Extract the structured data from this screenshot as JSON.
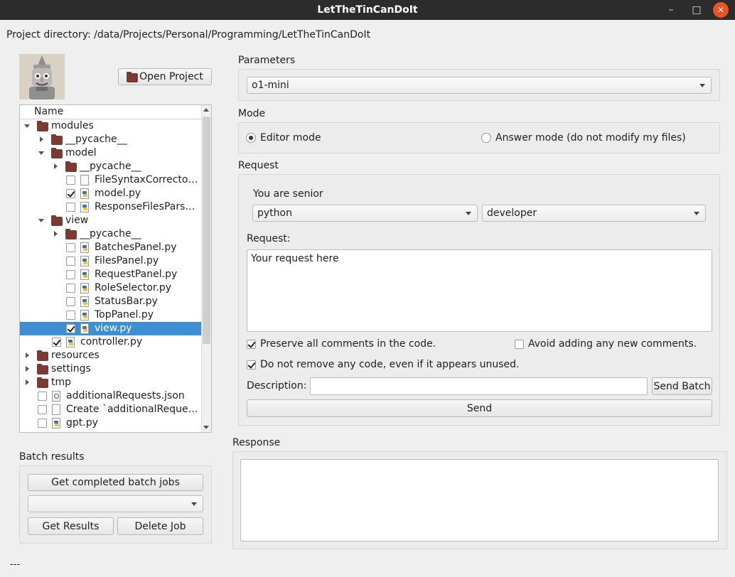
{
  "window": {
    "title": "LetTheTinCanDoIt",
    "minimize_glyph": "–",
    "maximize_glyph": "□",
    "close_glyph": "✕"
  },
  "project": {
    "directory_label": "Project directory: /data/Projects/Personal/Programming/LetTheTinCanDoIt",
    "open_button": "Open Project"
  },
  "tree": {
    "header": "Name",
    "rows": [
      {
        "label": "modules",
        "type": "folder",
        "depth": 0,
        "expander": "open",
        "checkbox": false
      },
      {
        "label": "__pycache__",
        "type": "folder",
        "depth": 1,
        "expander": "closed",
        "checkbox": false
      },
      {
        "label": "model",
        "type": "folder",
        "depth": 1,
        "expander": "open",
        "checkbox": false
      },
      {
        "label": "__pycache__",
        "type": "folder",
        "depth": 2,
        "expander": "closed",
        "checkbox": false
      },
      {
        "label": "FileSyntaxCorrecto…",
        "type": "file",
        "depth": 2,
        "checkbox": true,
        "checked": false
      },
      {
        "label": "model.py",
        "type": "py",
        "depth": 2,
        "checkbox": true,
        "checked": true
      },
      {
        "label": "ResponseFilesPars…",
        "type": "py",
        "depth": 2,
        "checkbox": true,
        "checked": false
      },
      {
        "label": "view",
        "type": "folder",
        "depth": 1,
        "expander": "open",
        "checkbox": false
      },
      {
        "label": "__pycache__",
        "type": "folder",
        "depth": 2,
        "expander": "closed",
        "checkbox": false
      },
      {
        "label": "BatchesPanel.py",
        "type": "py",
        "depth": 2,
        "checkbox": true,
        "checked": false
      },
      {
        "label": "FilesPanel.py",
        "type": "py",
        "depth": 2,
        "checkbox": true,
        "checked": false
      },
      {
        "label": "RequestPanel.py",
        "type": "py",
        "depth": 2,
        "checkbox": true,
        "checked": false
      },
      {
        "label": "RoleSelector.py",
        "type": "py",
        "depth": 2,
        "checkbox": true,
        "checked": false
      },
      {
        "label": "StatusBar.py",
        "type": "py",
        "depth": 2,
        "checkbox": true,
        "checked": false
      },
      {
        "label": "TopPanel.py",
        "type": "py",
        "depth": 2,
        "checkbox": true,
        "checked": false
      },
      {
        "label": "view.py",
        "type": "py",
        "depth": 2,
        "checkbox": true,
        "checked": true,
        "selected": true
      },
      {
        "label": "controller.py",
        "type": "py",
        "depth": 1,
        "checkbox": true,
        "checked": true
      },
      {
        "label": "resources",
        "type": "folder",
        "depth": 0,
        "expander": "closed",
        "checkbox": false
      },
      {
        "label": "settings",
        "type": "folder",
        "depth": 0,
        "expander": "closed",
        "checkbox": false
      },
      {
        "label": "tmp",
        "type": "folder",
        "depth": 0,
        "expander": "closed",
        "checkbox": false
      },
      {
        "label": "additionalRequests.json",
        "type": "json",
        "depth": 0,
        "checkbox": true,
        "checked": false
      },
      {
        "label": "Create `additionalReque…",
        "type": "file",
        "depth": 0,
        "checkbox": true,
        "checked": false
      },
      {
        "label": "gpt.py",
        "type": "py",
        "depth": 0,
        "checkbox": true,
        "checked": false
      }
    ]
  },
  "batch": {
    "title": "Batch results",
    "get_completed": "Get completed batch jobs",
    "select_value": "",
    "get_results": "Get Results",
    "delete_job": "Delete Job"
  },
  "parameters": {
    "title": "Parameters",
    "model_value": "o1-mini"
  },
  "mode": {
    "title": "Mode",
    "editor_label": "Editor mode",
    "answer_label": "Answer mode (do not modify my files)",
    "selected": "editor"
  },
  "request": {
    "title": "Request",
    "senior_label": "You are senior",
    "language_value": "python",
    "role_value": "developer",
    "request_label": "Request:",
    "request_text": "Your request here",
    "preserve_comments": "Preserve all comments in the code.",
    "preserve_checked": true,
    "avoid_comments": "Avoid adding any new comments.",
    "avoid_checked": false,
    "no_remove": "Do not remove any code, even if it appears unused.",
    "no_remove_checked": true,
    "description_label": "Description:",
    "description_value": "",
    "send_batch": "Send Batch",
    "send": "Send"
  },
  "response": {
    "title": "Response",
    "text": ""
  },
  "status": {
    "text": "---"
  },
  "colors": {
    "selection": "#3d8fd1",
    "titlebar": "#2c2c2c",
    "close_button": "#e95420",
    "folder": "#7a3b34"
  }
}
